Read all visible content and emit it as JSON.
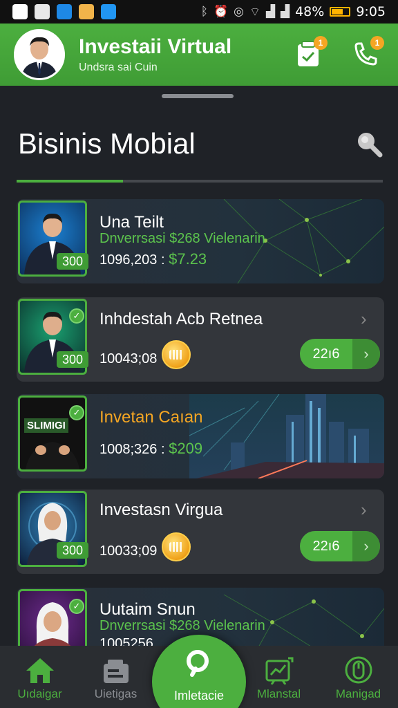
{
  "status_bar": {
    "battery": "48%",
    "time": "9:05",
    "app_icons": [
      "image-icon",
      "gallery-icon",
      "shazam-icon",
      "store-icon",
      "wallet-app-icon"
    ],
    "system_icons": [
      "bluetooth-icon",
      "alarm-icon",
      "vibrate-icon",
      "wifi-icon",
      "signal-icon",
      "signal-icon"
    ]
  },
  "header": {
    "title": "Investaii Virtual",
    "subtitle": "Undsra sai Cuin",
    "notifications": {
      "wallet": "1",
      "phone": "1"
    }
  },
  "section": {
    "title": "Bisinis Mobial",
    "progress": 0.29
  },
  "cards": [
    {
      "title": "Una Teilt",
      "subtitle": "Dnverrsasi $268 Vielenarin",
      "value": "1096,203",
      "sep": ":",
      "price": "$7.23",
      "badge": "300"
    },
    {
      "title": "Inhdestah Acb Retnea",
      "value": "10043;08",
      "pill": "22ı6",
      "badge": "300"
    },
    {
      "title": "Invetan Caıan",
      "value": "1008;326",
      "sep": ":",
      "price": "$209",
      "thumb_text": "SLIMIGI"
    },
    {
      "title": "Investasn Virgua",
      "value": "10033;09",
      "pill": "22ı6",
      "badge": "300"
    },
    {
      "title": "Uutaim Snun",
      "subtitle": "Dnverrsasi $268 Vielenarin",
      "value": "1005256"
    }
  ],
  "nav": [
    {
      "label": "Uıdaigar",
      "icon": "home-icon",
      "color": "#4caf3f"
    },
    {
      "label": "Uietigas",
      "icon": "wallet-icon",
      "color": "#8a8d92"
    },
    {
      "label": "Imletacie",
      "icon": "search-icon",
      "color": "#ffffff"
    },
    {
      "label": "Mlanstal",
      "icon": "chart-icon",
      "color": "#4caf3f"
    },
    {
      "label": "Manigad",
      "icon": "mouse-icon",
      "color": "#4caf3f"
    }
  ],
  "colors": {
    "accent": "#4caf3f",
    "background": "#1f2227",
    "card": "#33363b",
    "notification": "#f5a623"
  }
}
